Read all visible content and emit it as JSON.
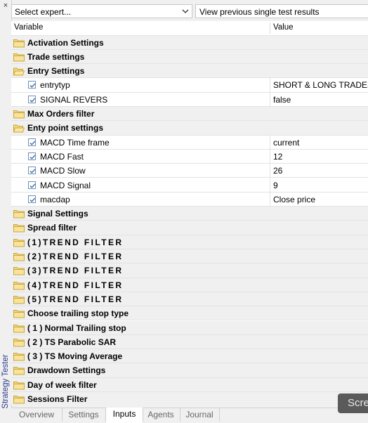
{
  "side_panel": {
    "close_glyph": "×",
    "title": "Strategy Tester"
  },
  "toolbar": {
    "expert_select": {
      "value": "Select expert...",
      "icon": "chevron-down-icon"
    },
    "view_results_label": "View previous single test results"
  },
  "table": {
    "headers": {
      "variable": "Variable",
      "value": "Value"
    },
    "rows": [
      {
        "kind": "group",
        "label": "Activation Settings",
        "open": false,
        "spaced": false
      },
      {
        "kind": "group",
        "label": "Trade settings",
        "open": false,
        "spaced": false
      },
      {
        "kind": "group",
        "label": "Entry Settings",
        "open": true,
        "spaced": false
      },
      {
        "kind": "param",
        "label": "entrytyp",
        "value": "SHORT & LONG TRADES",
        "checked": true
      },
      {
        "kind": "param",
        "label": "SIGNAL REVERS",
        "value": "false",
        "checked": true
      },
      {
        "kind": "group",
        "label": "Max Orders filter",
        "open": false,
        "spaced": false
      },
      {
        "kind": "group",
        "label": "Enty point settings",
        "open": true,
        "spaced": false
      },
      {
        "kind": "param",
        "label": "MACD Time frame",
        "value": "current",
        "checked": true
      },
      {
        "kind": "param",
        "label": "MACD Fast",
        "value": "12",
        "checked": true
      },
      {
        "kind": "param",
        "label": "MACD Slow",
        "value": "26",
        "checked": true
      },
      {
        "kind": "param",
        "label": "MACD Signal",
        "value": "9",
        "checked": true
      },
      {
        "kind": "param",
        "label": "macdap",
        "value": "Close price",
        "checked": true
      },
      {
        "kind": "group",
        "label": "Signal Settings",
        "open": false,
        "spaced": false
      },
      {
        "kind": "group",
        "label": "Spread filter",
        "open": false,
        "spaced": false
      },
      {
        "kind": "group",
        "label": "(1)TREND FILTER",
        "open": false,
        "spaced": true
      },
      {
        "kind": "group",
        "label": "(2)TREND FILTER",
        "open": false,
        "spaced": true
      },
      {
        "kind": "group",
        "label": "(3)TREND FILTER",
        "open": false,
        "spaced": true
      },
      {
        "kind": "group",
        "label": "(4)TREND FILTER",
        "open": false,
        "spaced": true
      },
      {
        "kind": "group",
        "label": "(5)TREND FILTER",
        "open": false,
        "spaced": true
      },
      {
        "kind": "group",
        "label": "Choose trailing stop type",
        "open": false,
        "spaced": false
      },
      {
        "kind": "group",
        "label": "( 1 ) Normal Trailing stop",
        "open": false,
        "spaced": false
      },
      {
        "kind": "group",
        "label": "( 2 ) TS Parabolic SAR",
        "open": false,
        "spaced": false
      },
      {
        "kind": "group",
        "label": "( 3 ) TS Moving Average",
        "open": false,
        "spaced": false
      },
      {
        "kind": "group",
        "label": "Drawdown Settings",
        "open": false,
        "spaced": false
      },
      {
        "kind": "group",
        "label": "Day of week filter",
        "open": false,
        "spaced": false
      },
      {
        "kind": "group",
        "label": "Sessions Filter",
        "open": false,
        "spaced": false
      }
    ]
  },
  "tabs": [
    {
      "label": "Overview",
      "active": false
    },
    {
      "label": "Settings",
      "active": false
    },
    {
      "label": "Inputs",
      "active": true
    },
    {
      "label": "Agents",
      "active": false
    },
    {
      "label": "Journal",
      "active": false
    }
  ],
  "overlay_button": {
    "label": "Scre"
  },
  "colors": {
    "folder_fill": "#f4d97a",
    "folder_edge": "#c9a640",
    "checkbox_border": "#6f8fb7",
    "checkmark": "#3a6ea5",
    "side_label": "#2a3c8a"
  }
}
